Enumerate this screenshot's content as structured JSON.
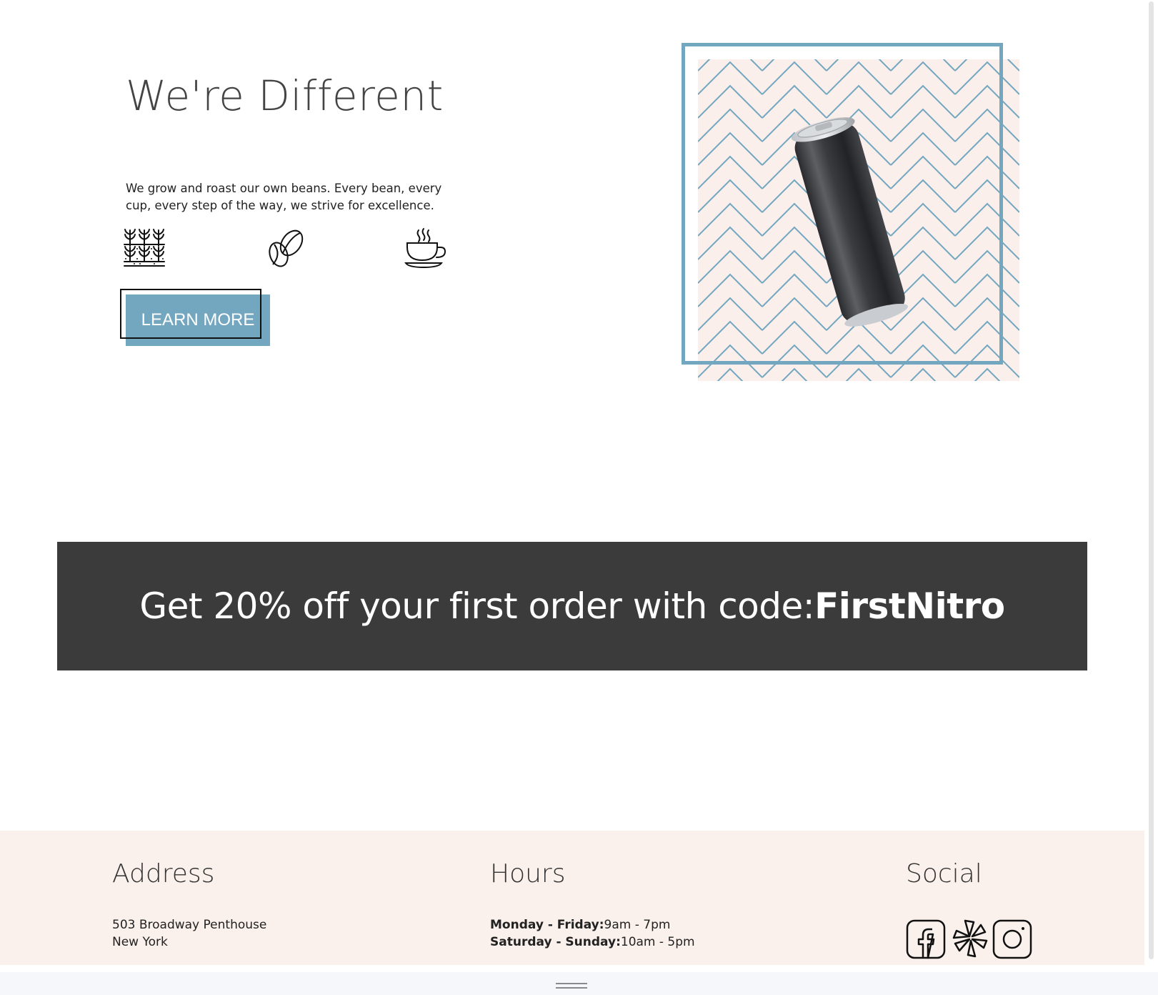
{
  "hero": {
    "title": "We're Different",
    "description": "We grow and roast our own beans. Every bean, every cup, every step of the way, we strive for excellence.",
    "features": [
      {
        "icon": "crop-field-icon"
      },
      {
        "icon": "coffee-bean-icon"
      },
      {
        "icon": "coffee-cup-icon"
      }
    ],
    "cta_label": "LEARN MORE"
  },
  "product_image": {
    "subject": "nitro-can-icon"
  },
  "promo": {
    "text": "Get 20% off your first order with code:",
    "code": "FirstNitro"
  },
  "footer": {
    "address": {
      "heading": "Address",
      "line1": "503 Broadway Penthouse",
      "line2": "New York"
    },
    "hours": {
      "heading": "Hours",
      "weekday_label": "Monday - Friday:",
      "weekday_hours": "9am - 7pm",
      "weekend_label": "Saturday - Sunday:",
      "weekend_hours": "10am - 5pm"
    },
    "social": {
      "heading": "Social",
      "links": [
        "facebook-icon",
        "yelp-icon",
        "instagram-icon"
      ]
    }
  },
  "colors": {
    "accent": "#73a6bf",
    "banner": "#3b3b3b",
    "footer_bg": "#faf0ec",
    "pattern_bg": "#fbefec"
  }
}
